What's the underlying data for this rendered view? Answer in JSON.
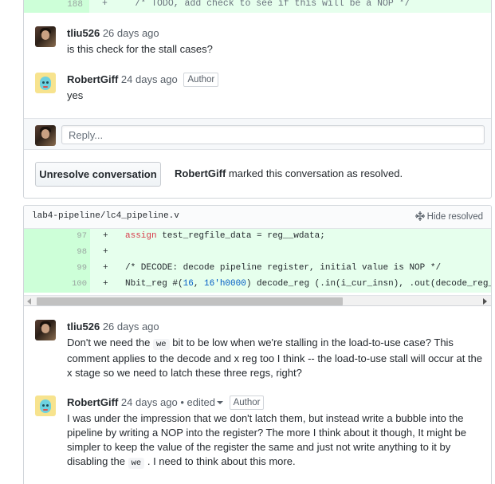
{
  "top_diff": {
    "line_number": "188",
    "marker": "+",
    "code": "/* TODO, add check to see if this will be a NOP */"
  },
  "thread1": {
    "comments": [
      {
        "author": "tliu526",
        "time": "26 days ago",
        "body": "is this check for the stall cases?",
        "avatar": "person-avatar"
      },
      {
        "author": "RobertGiff",
        "time": "24 days ago",
        "badge": "Author",
        "body": "yes",
        "avatar": "identicon-avatar"
      }
    ],
    "reply_placeholder": "Reply...",
    "unresolve_label": "Unresolve conversation",
    "resolved_author": "RobertGiff",
    "resolved_text": "marked this conversation as resolved."
  },
  "file": {
    "path": "lab4-pipeline/lc4_pipeline.v",
    "hide_resolved_label": "Hide resolved",
    "lines": [
      {
        "num": "97",
        "marker": "+",
        "kw": "assign",
        "rest": " test_regfile_data = reg__wdata;"
      },
      {
        "num": "98",
        "marker": "+",
        "kw": "",
        "rest": ""
      },
      {
        "num": "99",
        "marker": "+",
        "comment": "/* DECODE: decode pipeline register, initial value is NOP */"
      },
      {
        "num": "100",
        "marker": "+",
        "pre": "Nbit_reg #(",
        "n1": "16",
        "mid": ", ",
        "n2": "16'h0000",
        "post": ") decode_reg (.in(i_cur_insn), .out(decode_reg_out), .c"
      }
    ]
  },
  "thread2": {
    "comments": [
      {
        "author": "tliu526",
        "time": "26 days ago",
        "body_parts": [
          "Don't we need the ",
          "we",
          " bit to be low when we're stalling in the load-to-use case? This comment applies to the decode and x reg too I think -- the load-to-use stall will occur at the x stage so we need to latch these three regs, right?"
        ]
      },
      {
        "author": "RobertGiff",
        "time": "24 days ago",
        "edited": "• edited",
        "badge": "Author",
        "body_parts": [
          "I was under the impression that we don't latch them, but instead write a bubble into the pipeline by writing a NOP into the register? The more I think about it though, It might be simpler to keep the value of the register the same and just not write anything to it by disabling the ",
          "we",
          " . I need to think about this more."
        ]
      }
    ]
  },
  "colors": {
    "addition_bg": "#e6ffed",
    "addition_num_bg": "#cdffd8",
    "border": "#d1d5da",
    "keyword": "#d73a49",
    "comment": "#6a737d"
  }
}
